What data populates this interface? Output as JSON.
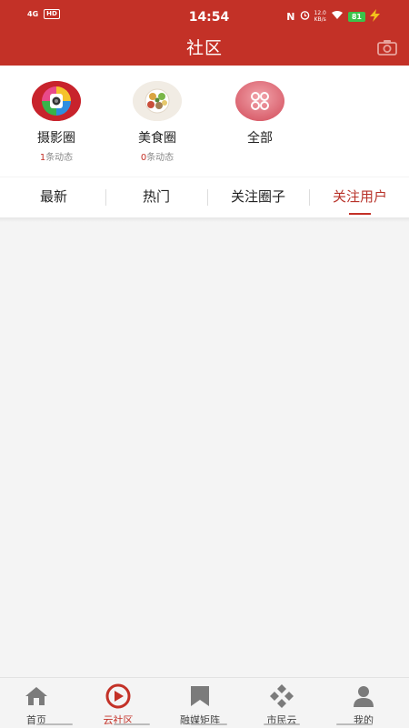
{
  "status_bar": {
    "network": "4G",
    "hd": "HD",
    "time": "14:54",
    "nfc": "N",
    "speed_value": "12.0",
    "speed_unit": "KB/s",
    "battery": "81"
  },
  "header": {
    "title": "社区",
    "camera_icon": "camera-icon"
  },
  "circles": [
    {
      "name": "摄影圈",
      "count": "1",
      "count_suffix": "条动态",
      "icon": "photography-icon"
    },
    {
      "name": "美食圈",
      "count": "0",
      "count_suffix": "条动态",
      "icon": "food-icon"
    },
    {
      "name": "全部",
      "icon": "all-circles-icon"
    }
  ],
  "tabs": [
    {
      "label": "最新",
      "active": false
    },
    {
      "label": "热门",
      "active": false
    },
    {
      "label": "关注圈子",
      "active": false
    },
    {
      "label": "关注用户",
      "active": true
    }
  ],
  "tabbar": [
    {
      "label": "首页",
      "icon": "home-icon",
      "active": false
    },
    {
      "label": "云社区",
      "icon": "cloud-community-icon",
      "active": true
    },
    {
      "label": "融媒矩阵",
      "icon": "bookmark-icon",
      "active": false
    },
    {
      "label": "市民云",
      "icon": "diamond-grid-icon",
      "active": false
    },
    {
      "label": "我的",
      "icon": "user-icon",
      "active": false
    }
  ],
  "colors": {
    "brand_red": "#c33127",
    "active_tab": "#b8332a",
    "battery_green": "#3cc24a"
  }
}
